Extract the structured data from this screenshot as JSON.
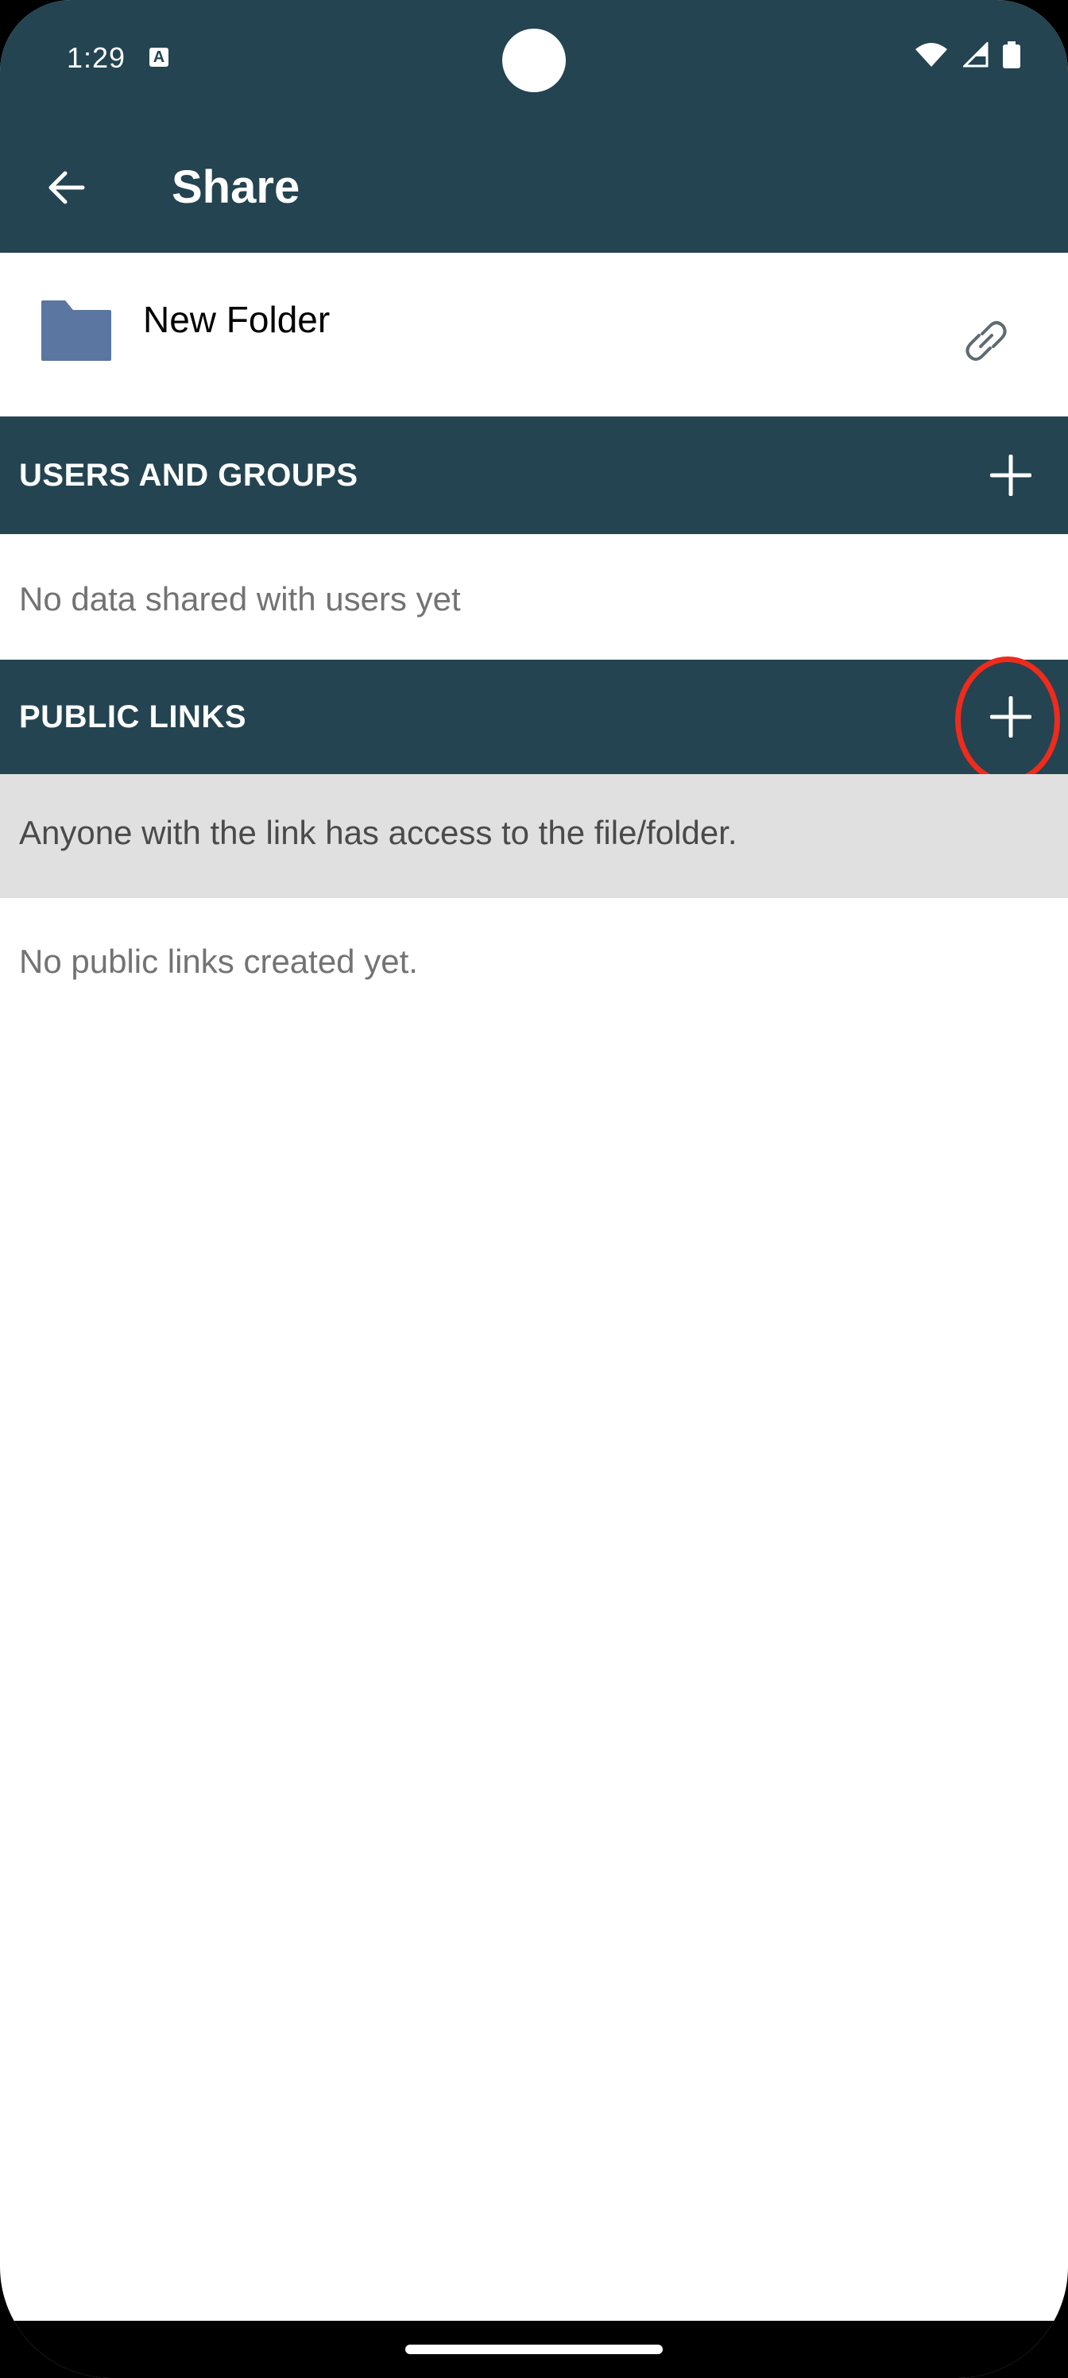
{
  "status_bar": {
    "time": "1:29",
    "notification_badge": "A",
    "icons": [
      "wifi-icon",
      "cell-signal-icon",
      "battery-icon"
    ]
  },
  "app_bar": {
    "title": "Share",
    "back_icon": "arrow-back-icon"
  },
  "file": {
    "name": "New Folder",
    "icon": "folder-icon",
    "action_icon": "link-icon"
  },
  "users_and_groups": {
    "header": "USERS AND GROUPS",
    "add_icon": "plus-icon",
    "empty_text": "No data shared with users yet"
  },
  "public_links": {
    "header": "PUBLIC LINKS",
    "add_icon": "plus-icon",
    "info_text": "Anyone with the link has access to the file/folder.",
    "empty_text": "No public links created yet."
  },
  "colors": {
    "primary": "#234450",
    "folder": "#5b76a0",
    "highlight": "#ee2b1c",
    "info_band": "#e0e0e0",
    "muted_text": "#737373"
  }
}
